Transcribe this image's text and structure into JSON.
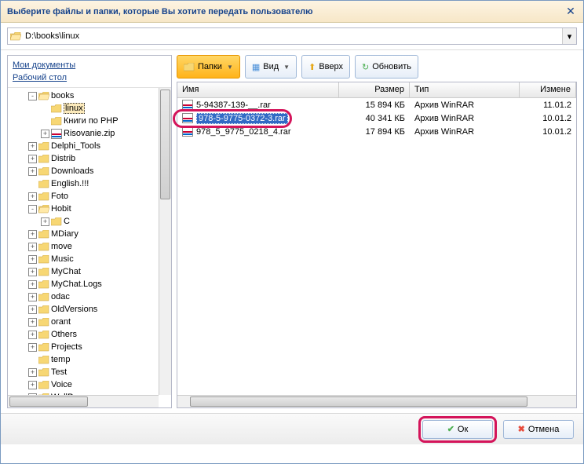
{
  "title": "Выберите файлы и папки, которые Вы хотите передать пользователю",
  "path": "D:\\books\\linux",
  "quick": {
    "docs": "Мои документы",
    "desk": "Рабочий стол"
  },
  "toolbar": {
    "folders": "Папки",
    "view": "Вид",
    "up": "Вверх",
    "refresh": "Обновить"
  },
  "headers": {
    "name": "Имя",
    "size": "Размер",
    "type": "Тип",
    "modified": "Измене"
  },
  "tree": [
    {
      "indent": 24,
      "toggle": "-",
      "icon": "folder-open",
      "label": "books"
    },
    {
      "indent": 40,
      "toggle": "",
      "icon": "folder",
      "label": "linux",
      "selected": true
    },
    {
      "indent": 40,
      "toggle": "",
      "icon": "folder",
      "label": "Книги по PHP"
    },
    {
      "indent": 40,
      "toggle": "+",
      "icon": "rar",
      "label": "Risovanie.zip"
    },
    {
      "indent": 24,
      "toggle": "+",
      "icon": "folder",
      "label": "Delphi_Tools"
    },
    {
      "indent": 24,
      "toggle": "+",
      "icon": "folder",
      "label": "Distrib"
    },
    {
      "indent": 24,
      "toggle": "+",
      "icon": "folder",
      "label": "Downloads"
    },
    {
      "indent": 24,
      "toggle": "",
      "icon": "folder",
      "label": "English.!!!"
    },
    {
      "indent": 24,
      "toggle": "+",
      "icon": "folder",
      "label": "Foto"
    },
    {
      "indent": 24,
      "toggle": "-",
      "icon": "folder-open",
      "label": "Hobit"
    },
    {
      "indent": 40,
      "toggle": "+",
      "icon": "folder",
      "label": "C"
    },
    {
      "indent": 24,
      "toggle": "+",
      "icon": "folder",
      "label": "MDiary"
    },
    {
      "indent": 24,
      "toggle": "+",
      "icon": "folder",
      "label": "move"
    },
    {
      "indent": 24,
      "toggle": "+",
      "icon": "folder",
      "label": "Music"
    },
    {
      "indent": 24,
      "toggle": "+",
      "icon": "folder",
      "label": "MyChat"
    },
    {
      "indent": 24,
      "toggle": "+",
      "icon": "folder",
      "label": "MyChat.Logs"
    },
    {
      "indent": 24,
      "toggle": "+",
      "icon": "folder",
      "label": "odac"
    },
    {
      "indent": 24,
      "toggle": "+",
      "icon": "folder",
      "label": "OldVersions"
    },
    {
      "indent": 24,
      "toggle": "+",
      "icon": "folder",
      "label": "orant"
    },
    {
      "indent": 24,
      "toggle": "+",
      "icon": "folder",
      "label": "Others"
    },
    {
      "indent": 24,
      "toggle": "+",
      "icon": "folder",
      "label": "Projects"
    },
    {
      "indent": 24,
      "toggle": "",
      "icon": "folder",
      "label": "temp"
    },
    {
      "indent": 24,
      "toggle": "+",
      "icon": "folder",
      "label": "Test"
    },
    {
      "indent": 24,
      "toggle": "+",
      "icon": "folder",
      "label": "Voice"
    },
    {
      "indent": 24,
      "toggle": "+",
      "icon": "folder",
      "label": "WallPapers"
    }
  ],
  "files": [
    {
      "name": "5-94387-139-__.rar",
      "size": "15 894 КБ",
      "type": "Архив WinRAR",
      "mod": "11.01.2",
      "selected": false
    },
    {
      "name": "978-5-9775-0372-3.rar",
      "size": "40 341 КБ",
      "type": "Архив WinRAR",
      "mod": "10.01.2",
      "selected": true
    },
    {
      "name": "978_5_9775_0218_4.rar",
      "size": "17 894 КБ",
      "type": "Архив WinRAR",
      "mod": "10.01.2",
      "selected": false
    }
  ],
  "buttons": {
    "ok": "Ок",
    "cancel": "Отмена"
  }
}
